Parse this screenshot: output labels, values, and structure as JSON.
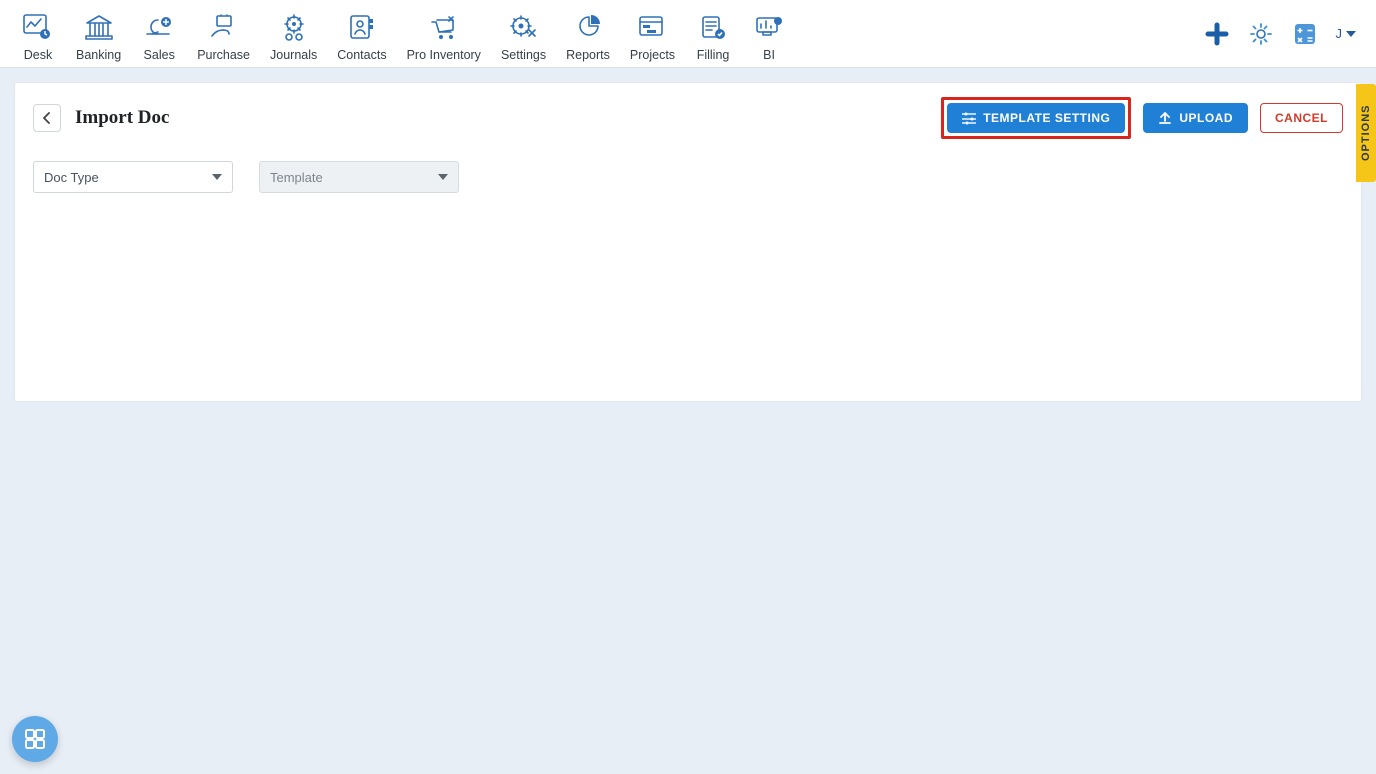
{
  "nav": {
    "items": [
      {
        "label": "Desk"
      },
      {
        "label": "Banking"
      },
      {
        "label": "Sales"
      },
      {
        "label": "Purchase"
      },
      {
        "label": "Journals"
      },
      {
        "label": "Contacts"
      },
      {
        "label": "Pro Inventory"
      },
      {
        "label": "Settings"
      },
      {
        "label": "Reports"
      },
      {
        "label": "Projects"
      },
      {
        "label": "Filling"
      },
      {
        "label": "BI"
      }
    ]
  },
  "user": {
    "initial": "J"
  },
  "page": {
    "title": "Import Doc",
    "actions": {
      "template_setting": "Template Setting",
      "upload": "Upload",
      "cancel": "Cancel"
    },
    "filters": {
      "doc_type_label": "Doc Type",
      "template_label": "Template"
    }
  },
  "side_tab": {
    "label": "OPTIONS"
  }
}
